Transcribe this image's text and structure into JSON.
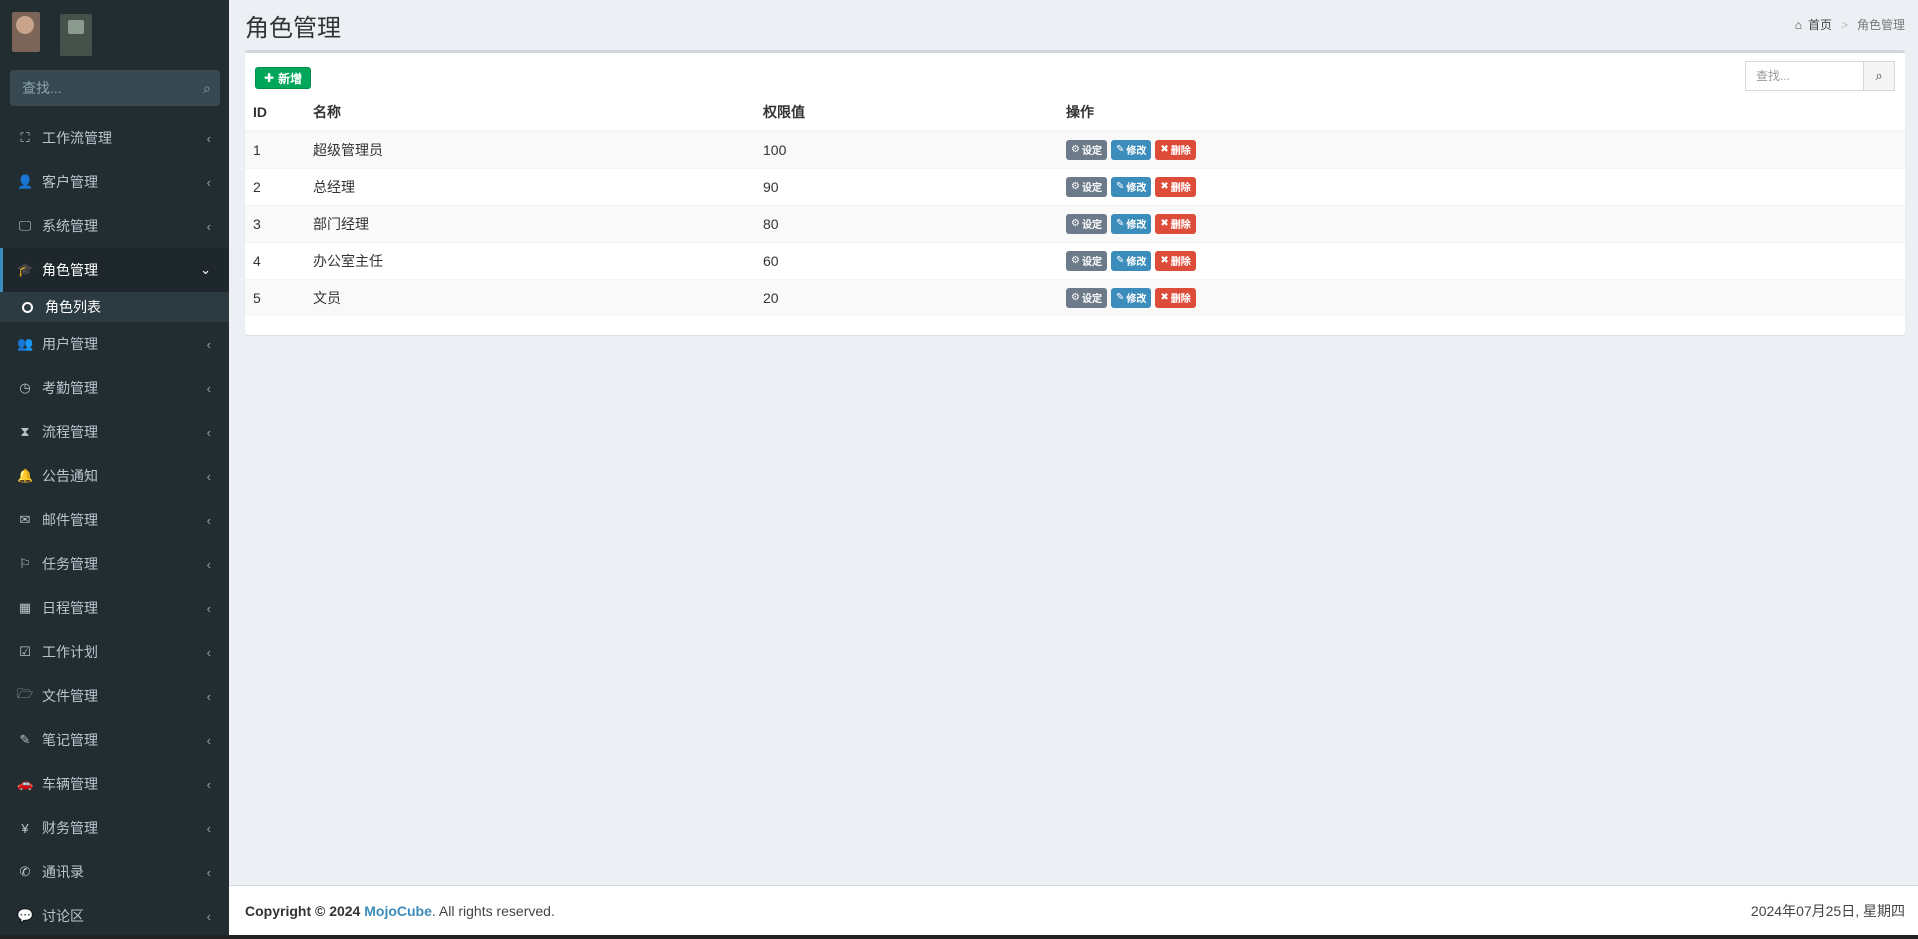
{
  "sidebar": {
    "search_placeholder": "查找...",
    "items": [
      {
        "label": "工作流管理",
        "icon": "sitemap-icon",
        "glyph": "⛶"
      },
      {
        "label": "客户管理",
        "icon": "user-icon",
        "glyph": "👤"
      },
      {
        "label": "系统管理",
        "icon": "desktop-icon",
        "glyph": "🖵"
      },
      {
        "label": "角色管理",
        "icon": "graduation-cap-icon",
        "glyph": "🎓",
        "active": true
      },
      {
        "label": "用户管理",
        "icon": "users-icon",
        "glyph": "👥"
      },
      {
        "label": "考勤管理",
        "icon": "clock-icon",
        "glyph": "◷"
      },
      {
        "label": "流程管理",
        "icon": "hourglass-icon",
        "glyph": "⧗"
      },
      {
        "label": "公告通知",
        "icon": "bell-icon",
        "glyph": "🔔"
      },
      {
        "label": "邮件管理",
        "icon": "envelope-icon",
        "glyph": "✉"
      },
      {
        "label": "任务管理",
        "icon": "flag-icon",
        "glyph": "⚐"
      },
      {
        "label": "日程管理",
        "icon": "calendar-icon",
        "glyph": "▦"
      },
      {
        "label": "工作计划",
        "icon": "calendar-check-icon",
        "glyph": "☑"
      },
      {
        "label": "文件管理",
        "icon": "folder-open-icon",
        "glyph": "🗁"
      },
      {
        "label": "笔记管理",
        "icon": "edit-icon",
        "glyph": "✎"
      },
      {
        "label": "车辆管理",
        "icon": "car-icon",
        "glyph": "🚗"
      },
      {
        "label": "财务管理",
        "icon": "yen-icon",
        "glyph": "¥"
      },
      {
        "label": "通讯录",
        "icon": "phone-icon",
        "glyph": "✆"
      },
      {
        "label": "讨论区",
        "icon": "comments-icon",
        "glyph": "💬"
      }
    ],
    "active_sub": "角色列表"
  },
  "header": {
    "title": "角色管理",
    "breadcrumb_home": "首页",
    "breadcrumb_current": "角色管理"
  },
  "toolbar": {
    "add_label": "新增",
    "search_placeholder": "查找..."
  },
  "table": {
    "headers": [
      "ID",
      "名称",
      "权限值",
      "操作"
    ],
    "rows": [
      {
        "id": "1",
        "name": "超级管理员",
        "value": "100"
      },
      {
        "id": "2",
        "name": "总经理",
        "value": "90"
      },
      {
        "id": "3",
        "name": "部门经理",
        "value": "80"
      },
      {
        "id": "4",
        "name": "办公室主任",
        "value": "60"
      },
      {
        "id": "5",
        "name": "文员",
        "value": "20"
      }
    ],
    "actions": {
      "set": "设定",
      "edit": "修改",
      "delete": "删除"
    }
  },
  "footer": {
    "copyright_prefix": "Copyright © 2024",
    "brand": "MojoCube",
    "suffix": ". All rights reserved.",
    "date": "2024年07月25日, 星期四"
  },
  "colors": {
    "sidebar_bg": "#222d32",
    "active_accent": "#3c8dbc",
    "add_green": "#00a65a",
    "delete_red": "#dd4b39",
    "set_gray": "#6c7a89"
  }
}
